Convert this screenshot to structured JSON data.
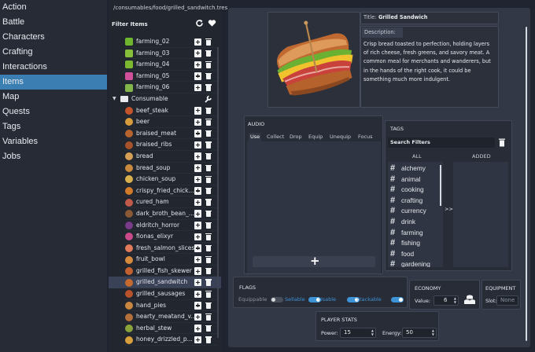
{
  "nav": {
    "items": [
      "Action",
      "Battle",
      "Characters",
      "Crafting",
      "Interactions",
      "Items",
      "Map",
      "Quests",
      "Tags",
      "Variables",
      "Jobs"
    ],
    "selected": "Items"
  },
  "items_panel": {
    "path": "/consumables/food/grilled_sandwitch.tres",
    "filter_label": "Filter Items",
    "farming": [
      "farming_02",
      "farming_03",
      "farming_04",
      "farming_05",
      "farming_06"
    ],
    "group_label": "Consumable",
    "consumables": [
      "beef_steak",
      "beer",
      "braised_meat",
      "braised_ribs",
      "bread",
      "bread_soup",
      "chicken_soup",
      "crispy_fried_chick...",
      "cured_ham",
      "dark_broth_bean_...",
      "eldritch_horror",
      "fionas_elixyr",
      "fresh_salmon_slices",
      "fruit_bowl",
      "grilled_fish_skewer",
      "grilled_sandwitch",
      "grilled_sausages",
      "hand_pies",
      "hearty_meatand_v...",
      "herbal_stew",
      "honey_drizzled_p..."
    ],
    "selected": "grilled_sandwitch"
  },
  "detail": {
    "title_label": "Title:",
    "title_value": "Grilled Sandwich",
    "description_label": "Description:",
    "description_lines": [
      "Crisp bread toasted to perfection, holding layers",
      "of rich cheese, fresh greens, and savory meat. A",
      "common meal for merchants and wanderers, but",
      "in the hands of the right cook, it could be",
      "something much more indulgent."
    ]
  },
  "audio": {
    "title": "AUDIO",
    "tabs": [
      "Use",
      "Collect",
      "Drop",
      "Equip",
      "Unequip",
      "Focus"
    ],
    "active_tab": "Use",
    "add_glyph": "+"
  },
  "tags": {
    "title": "TAGS",
    "search_placeholder": "Search Filters",
    "all_label": "ALL",
    "added_label": "ADDED",
    "move_label": ">>",
    "hash_glyph": "#",
    "all": [
      "alchemy",
      "animal",
      "cooking",
      "crafting",
      "currency",
      "drink",
      "farming",
      "fishing",
      "food",
      "gardening"
    ]
  },
  "flags": {
    "title": "FLAGS",
    "items": [
      {
        "label": "Equippable",
        "on": false
      },
      {
        "label": "Sellable",
        "on": true
      },
      {
        "label": "Usable",
        "on": true
      },
      {
        "label": "Stackable",
        "on": true
      }
    ]
  },
  "economy": {
    "title": "ECONOMY",
    "value_label": "Value:",
    "value": "6"
  },
  "equipment": {
    "title": "EQUIPMENT",
    "slot_label": "Slot:",
    "slot_value": "None"
  },
  "player_stats": {
    "title": "PLAYER STATS",
    "power_label": "Power:",
    "power_value": "15",
    "energy_label": "Energy:",
    "energy_value": "50"
  },
  "colors": {
    "accent": "#3b7fb2",
    "toggle_on": "#3e93d6"
  },
  "icons": [
    "refresh-icon",
    "heart-icon",
    "folder-icon",
    "add-icon",
    "trash-icon",
    "tag-hash-icon",
    "coins-icon"
  ]
}
